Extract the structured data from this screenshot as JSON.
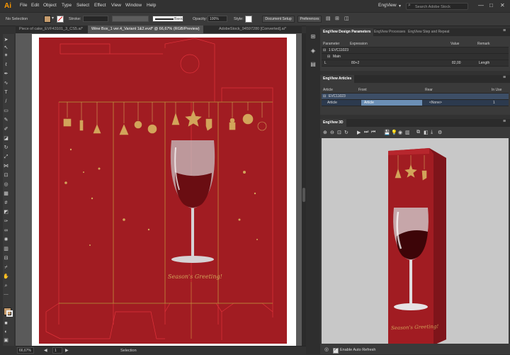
{
  "app": {
    "logo": "Ai"
  },
  "menu": [
    "File",
    "Edit",
    "Object",
    "Type",
    "Select",
    "Effect",
    "View",
    "Window",
    "Help"
  ],
  "menu_right": {
    "workspace": "EngView",
    "search_placeholder": "Search Adobe Stock"
  },
  "window_controls": {
    "minimize": "—",
    "maximize": "□",
    "close": "✕"
  },
  "control_bar": {
    "selection": "No Selection",
    "stroke_label": "Stroke:",
    "stroke_style": "Basic",
    "opacity_label": "Opacity:",
    "opacity_value": "100%",
    "style_label": "Style:",
    "document_setup": "Document Setup",
    "preferences": "Preferences"
  },
  "doc_tabs": [
    "Piece of cake_EVF43101_3_CS5.ai*",
    "Wine Box_1 ver.4_Variant 1&2.evd* @ 66,67% (RGB/Preview)",
    "AdobeStock_94597280 [Converted].ai*"
  ],
  "artwork": {
    "greeting": "Season's Greeting!"
  },
  "status": {
    "zoom": "66,67%",
    "page": "1",
    "mode": "Selection"
  },
  "design_params": {
    "tabs": [
      "EngView Design Parameters",
      "EngView Processes",
      "EngView Step and Repeat"
    ],
    "headers": [
      "Parameter",
      "Expression",
      "Value",
      "Remark"
    ],
    "rows": [
      {
        "parameter": "1 EVC11023",
        "expression": "",
        "value": "",
        "remark": ""
      },
      {
        "parameter": "Main",
        "expression": "",
        "value": "",
        "remark": ""
      },
      {
        "parameter": "L",
        "expression": "80+2",
        "value": "82,00",
        "remark": "Length"
      }
    ]
  },
  "articles": {
    "tab": "EngView Articles",
    "headers": [
      "Article",
      "Front",
      "Rear",
      "In Use"
    ],
    "group": "EVC11023",
    "row": {
      "article": "Article",
      "front": "Article",
      "rear": "<None>",
      "in_use": "1"
    }
  },
  "view3d": {
    "tab": "EngView 3D",
    "auto_refresh": "Enable Auto Refresh",
    "greeting": "Season's Greeting!"
  },
  "colors": {
    "wine_red": "#a11c22",
    "gold": "#d2a45a",
    "accent_blue": "#3d6c9a",
    "orange_logo": "#ff9a00"
  }
}
